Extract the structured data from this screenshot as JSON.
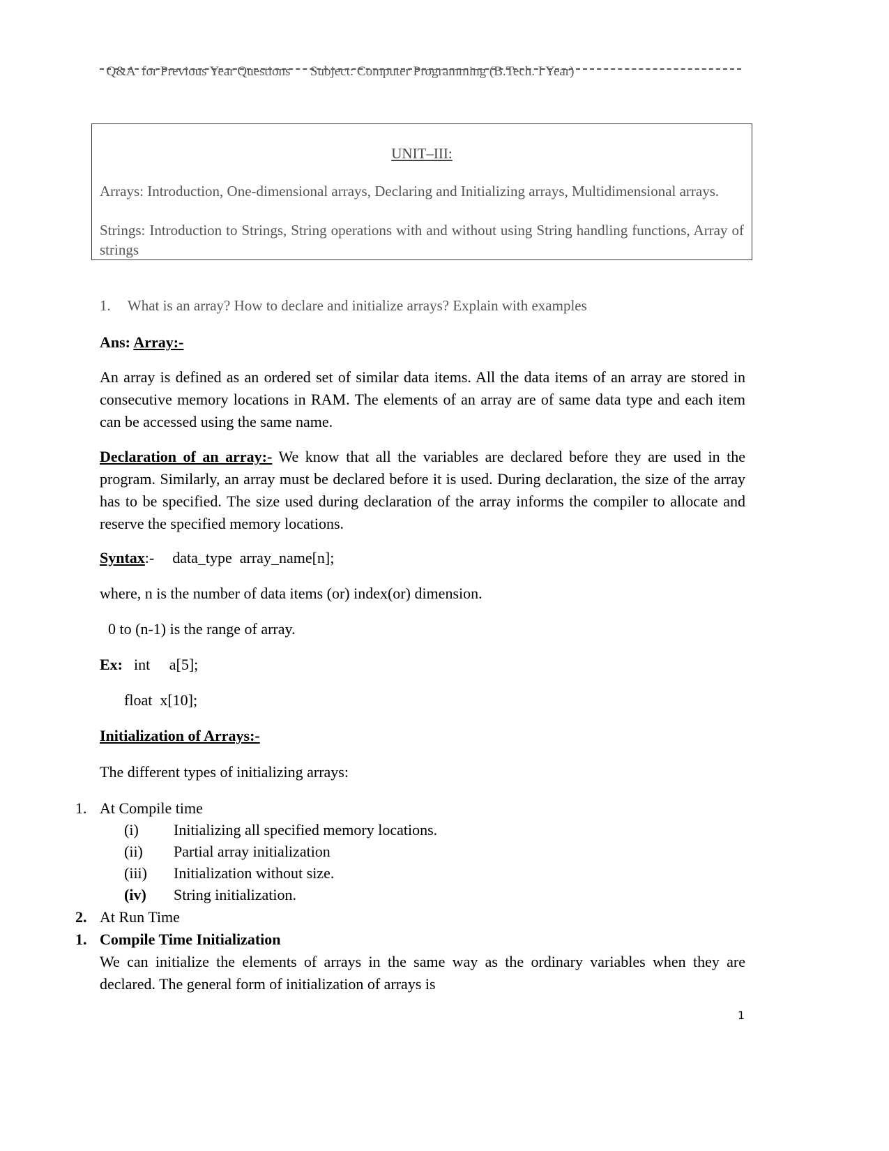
{
  "header": {
    "left": "Q&A  for Previous Year Questions",
    "right": "Subject: Computer Programming (B.Tech. I Year)"
  },
  "unit_box": {
    "title": "UNIT–III:",
    "arrays_topics": "Arrays: Introduction, One-dimensional arrays, Declaring and Initializing arrays, Multidimensional arrays.",
    "strings_topics": "Strings: Introduction to Strings, String operations with and without using String handling functions, Array of strings"
  },
  "question": {
    "number": "1.",
    "text": "What is an array? How to declare and initialize arrays? Explain with examples"
  },
  "answer": {
    "ans_label": "Ans:",
    "array_heading": "Array:-",
    "definition": " An array is defined as an ordered set of similar data items. All the data items of an array are stored in consecutive memory locations in RAM. The elements of an array are of same data type and each item can be accessed using the same name.",
    "declaration_heading": "Declaration of an array:-",
    "declaration_text": " We know that all the variables are declared before they are used in the program. Similarly, an array must be declared before it is used. During declaration, the size of the array has to be specified. The size used during declaration of the array informs the compiler to allocate and reserve the specified memory locations.",
    "syntax_label": "Syntax",
    "syntax_suffix": ":-",
    "syntax_code": "data_type  array_name[n];",
    "where_text": "where, n is the number of data items (or) index(or) dimension.",
    "range_text": "0 to (n-1) is the range of array.",
    "ex_label": "Ex:",
    "ex_line1": "int     a[5];",
    "ex_line2": "float  x[10];",
    "init_heading": "Initialization of Arrays:-",
    "init_intro": "The different types of initializing arrays:",
    "types": [
      {
        "num": "1.",
        "label": "At Compile time",
        "subitems": [
          {
            "num": "(i)",
            "text": "Initializing all specified memory locations."
          },
          {
            "num": "(ii)",
            "text": "Partial array initialization"
          },
          {
            "num": "(iii)",
            "text": "Initialization without size."
          },
          {
            "num": "(iv)",
            "text": "String initialization."
          }
        ]
      },
      {
        "num": "2.",
        "label": "At Run Time"
      }
    ],
    "compile_time": {
      "num": "1.",
      "heading": "Compile Time Initialization",
      "text": "We can initialize the elements of arrays in the same way as the ordinary variables when they are declared. The general form of initialization of arrays is"
    }
  },
  "page_number": "1"
}
